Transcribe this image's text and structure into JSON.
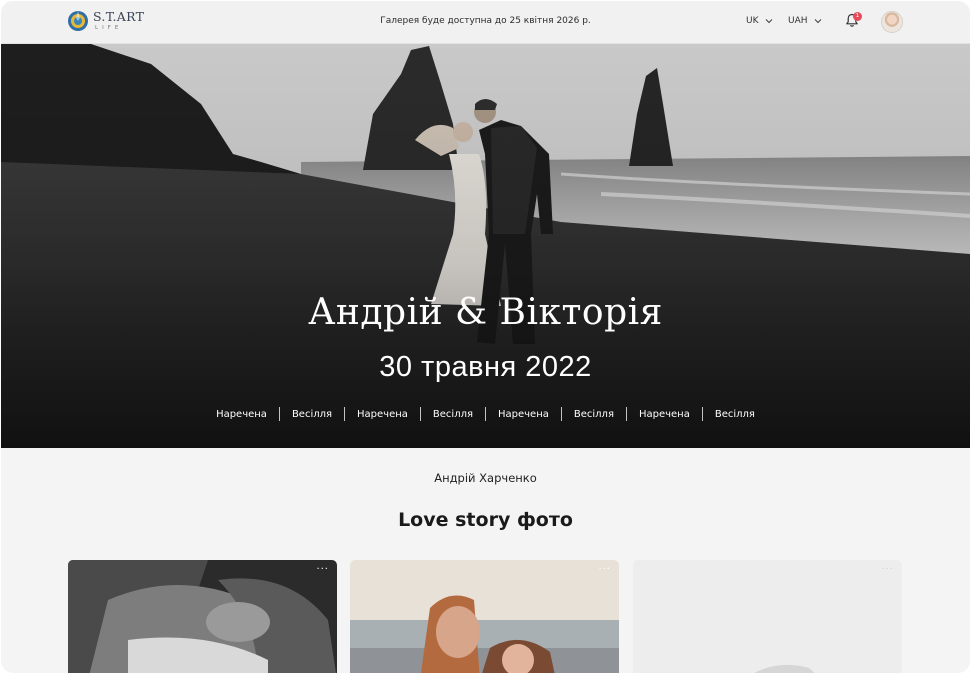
{
  "header": {
    "logo_name": "S.T.ART",
    "logo_sub": "LIFE",
    "notice": "Галерея буде доступна до 25 квітня 2026 р.",
    "language": "UK",
    "currency": "UAH",
    "notifications_count": "1"
  },
  "hero": {
    "title": "Андрій & Вікторія",
    "date": "30 травня 2022",
    "tags": [
      "Наречена",
      "Весілля",
      "Наречена",
      "Весілля",
      "Наречена",
      "Весілля",
      "Наречена",
      "Весілля"
    ]
  },
  "content": {
    "photographer": "Андрій Харченко",
    "section_title": "Love story фото",
    "card_menu": "···"
  },
  "icons": {
    "logo": "logo-icon",
    "language_chevron": "chevron-down-icon",
    "currency_chevron": "chevron-down-icon",
    "notifications": "bell-icon",
    "avatar": "user-avatar"
  },
  "colors": {
    "header_bg": "#f1f1f1",
    "page_bg": "#f4f4f4",
    "badge": "#e54b5a",
    "logo_blue": "#2f6fa3",
    "logo_yellow": "#e5b73b"
  }
}
